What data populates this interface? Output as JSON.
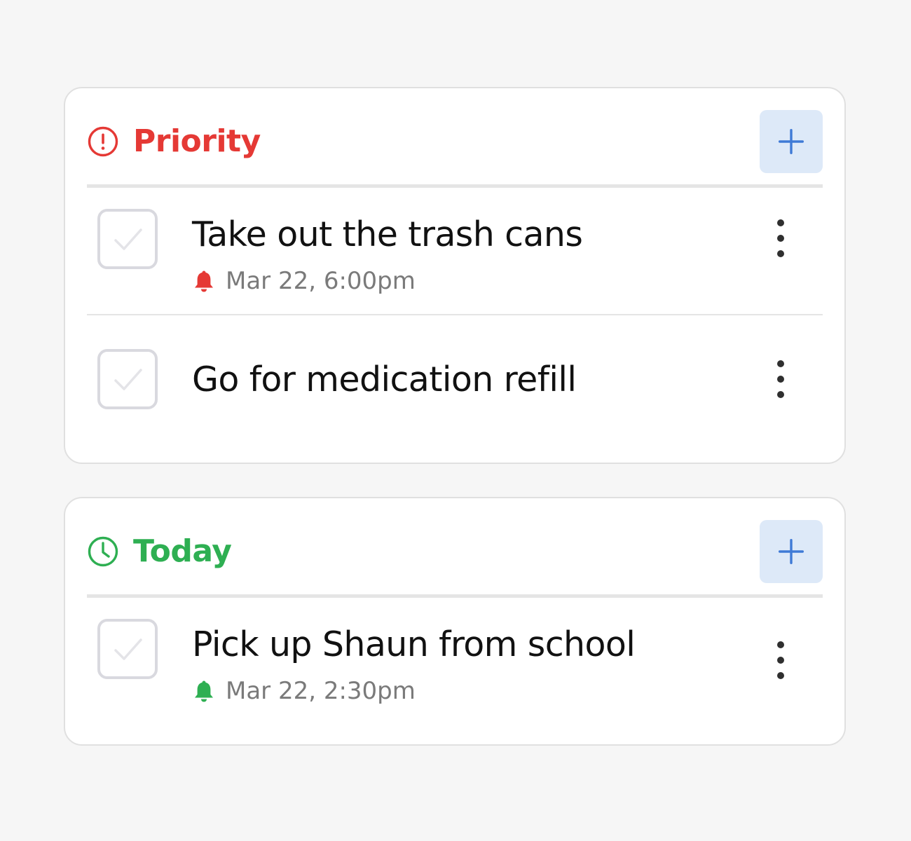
{
  "colors": {
    "priority": "#e53935",
    "today": "#2eaf52",
    "add_button_bg": "#dde9f8",
    "add_button_icon": "#3f7ad6",
    "task_text": "#111111",
    "meta_text": "#7a7a7a",
    "checkbox_border": "#d9d9df",
    "checkmark": "#e4e4e8"
  },
  "sections": [
    {
      "title": "Priority",
      "icon": "alert-circle-icon",
      "add_icon": "plus-icon",
      "tasks": [
        {
          "title": "Take out the trash cans",
          "reminder": "Mar 22, 6:00pm",
          "reminder_icon": "bell-icon",
          "more_icon": "more-vertical-icon",
          "checked": false
        },
        {
          "title": "Go for medication refill",
          "more_icon": "more-vertical-icon",
          "checked": false
        }
      ]
    },
    {
      "title": "Today",
      "icon": "clock-icon",
      "add_icon": "plus-icon",
      "tasks": [
        {
          "title": "Pick up Shaun from school",
          "reminder": "Mar 22, 2:30pm",
          "reminder_icon": "bell-icon",
          "more_icon": "more-vertical-icon",
          "checked": false
        }
      ]
    }
  ]
}
